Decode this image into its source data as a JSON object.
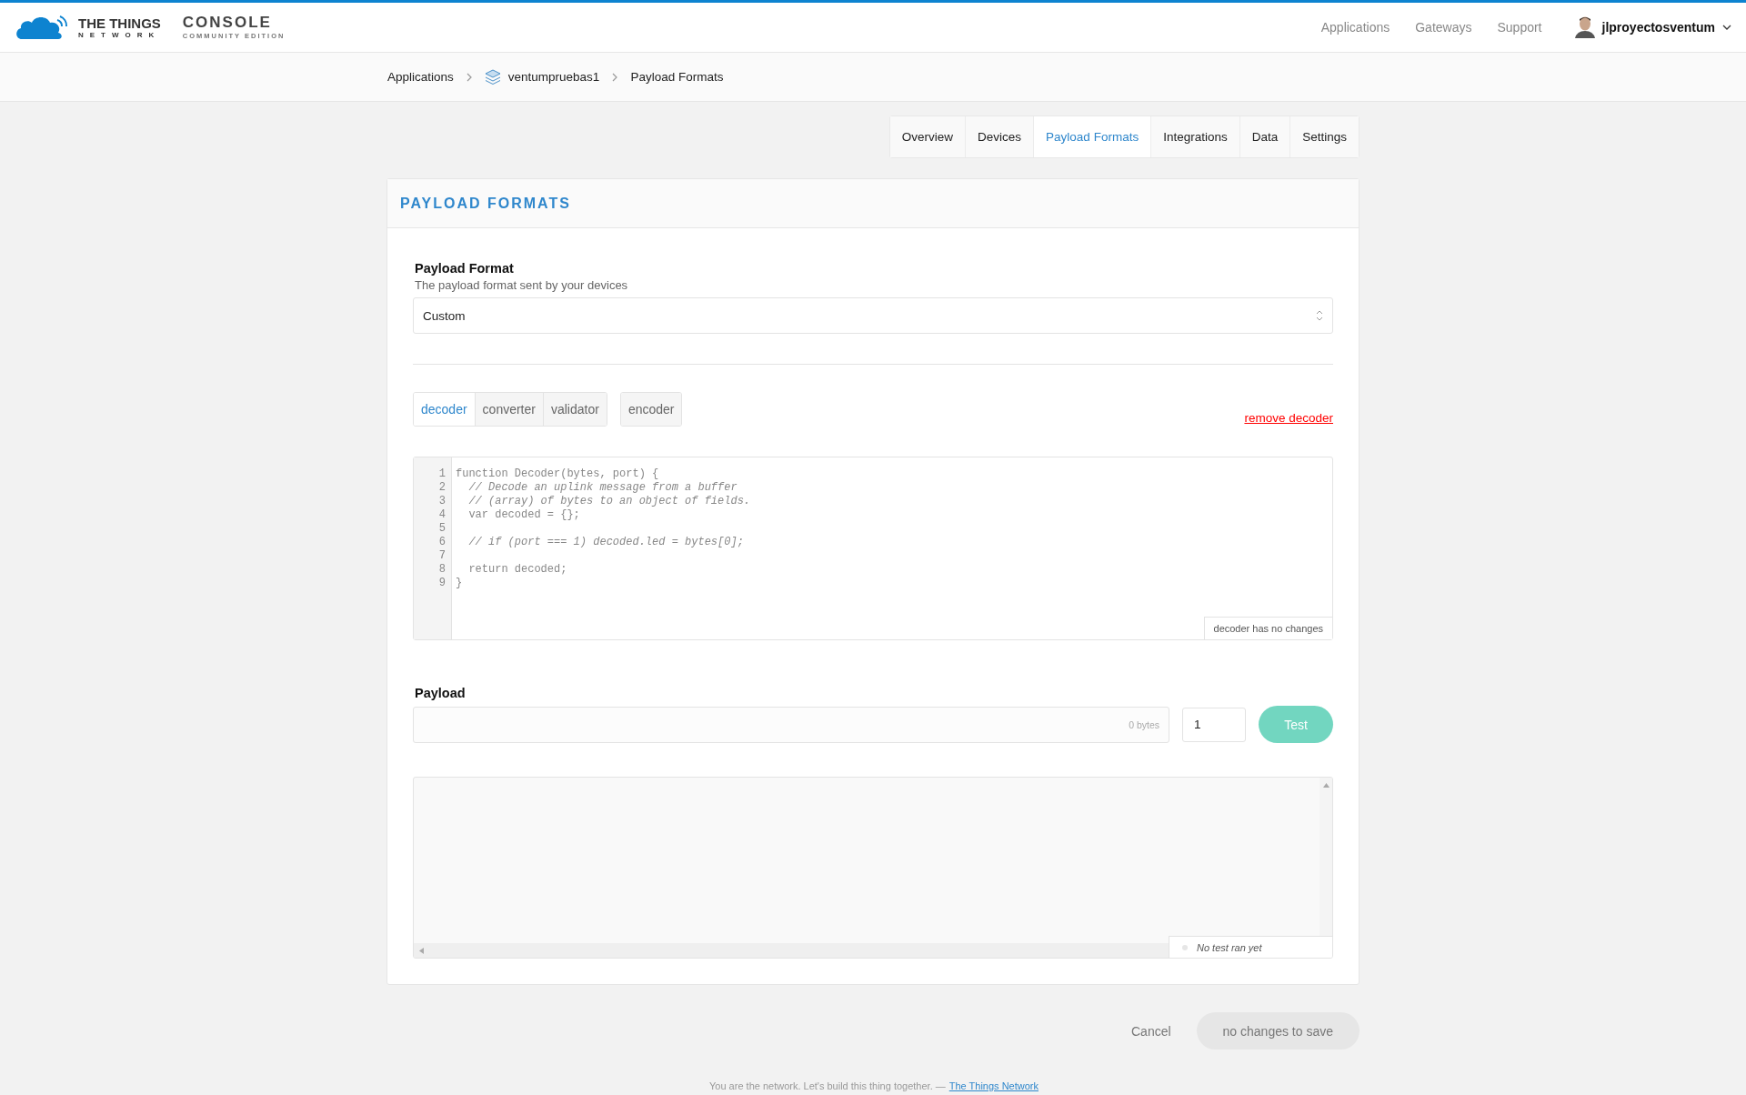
{
  "header": {
    "logo_line1": "THE THINGS",
    "logo_line2": "NETWORK",
    "console_title": "CONSOLE",
    "console_subtitle": "COMMUNITY EDITION",
    "nav": [
      "Applications",
      "Gateways",
      "Support"
    ],
    "user": "jlproyectosventum"
  },
  "breadcrumbs": [
    {
      "label": "Applications",
      "kind": "link"
    },
    {
      "label": "ventumpruebas1",
      "kind": "app"
    },
    {
      "label": "Payload Formats",
      "kind": "current"
    }
  ],
  "tabs": [
    {
      "label": "Overview",
      "selected": false
    },
    {
      "label": "Devices",
      "selected": false
    },
    {
      "label": "Payload Formats",
      "selected": true
    },
    {
      "label": "Integrations",
      "selected": false
    },
    {
      "label": "Data",
      "selected": false
    },
    {
      "label": "Settings",
      "selected": false
    }
  ],
  "card": {
    "title": "PAYLOAD FORMATS",
    "payload_format": {
      "label": "Payload Format",
      "hint": "The payload format sent by your devices",
      "value": "Custom"
    },
    "function_tab_groups": [
      {
        "tabs": [
          {
            "label": "decoder",
            "selected": true
          },
          {
            "label": "converter",
            "selected": false
          },
          {
            "label": "validator",
            "selected": false
          }
        ]
      },
      {
        "tabs": [
          {
            "label": "encoder",
            "selected": false
          }
        ]
      }
    ],
    "remove_link": "remove decoder",
    "editor": {
      "lines": [
        {
          "number": "1",
          "text": "function Decoder(bytes, port) {",
          "kind": "code"
        },
        {
          "number": "2",
          "text": "  // Decode an uplink message from a buffer",
          "kind": "comment"
        },
        {
          "number": "3",
          "text": "  // (array) of bytes to an object of fields.",
          "kind": "comment"
        },
        {
          "number": "4",
          "text": "  var decoded = {};",
          "kind": "code"
        },
        {
          "number": "5",
          "kind": "code"
        },
        {
          "number": "6",
          "text": "  // if (port === 1) decoded.led = bytes[0];",
          "kind": "comment"
        },
        {
          "number": "7",
          "kind": "code"
        },
        {
          "number": "8",
          "text": "  return decoded;",
          "kind": "code"
        },
        {
          "number": "9",
          "text": "}",
          "kind": "code"
        }
      ],
      "status": "decoder has no changes"
    },
    "payload": {
      "label": "Payload",
      "bytes": "0 bytes",
      "port": "1",
      "test_button": "Test"
    },
    "result": {
      "status": "No test ran yet"
    }
  },
  "actions": {
    "cancel": "Cancel",
    "save": "no changes to save"
  },
  "footer": {
    "text": "You are the network. Let's build this thing together. —",
    "link": "The Things Network"
  }
}
